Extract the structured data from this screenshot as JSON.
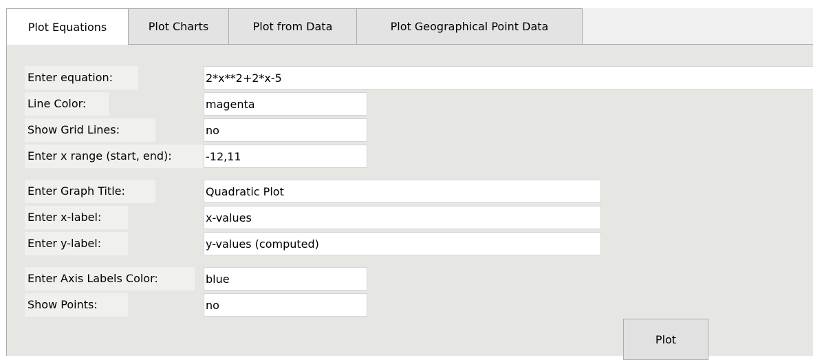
{
  "tabs": [
    {
      "label": "Plot Equations",
      "active": true
    },
    {
      "label": "Plot Charts",
      "active": false
    },
    {
      "label": "Plot from Data",
      "active": false
    },
    {
      "label": "Plot Geographical Point Data",
      "active": false
    }
  ],
  "form": {
    "equation": {
      "label": "Enter equation:",
      "value": "2*x**2+2*x-5"
    },
    "line_color": {
      "label": "Line Color:",
      "value": "magenta"
    },
    "show_grid": {
      "label": "Show Grid Lines:",
      "value": "no"
    },
    "x_range": {
      "label": "Enter x range (start, end):",
      "value": "-12,11"
    },
    "graph_title": {
      "label": "Enter Graph Title:",
      "value": "Quadratic Plot"
    },
    "x_label": {
      "label": "Enter x-label:",
      "value": "x-values"
    },
    "y_label": {
      "label": "Enter y-label:",
      "value": "y-values (computed)"
    },
    "axis_labels_color": {
      "label": "Enter Axis Labels Color:",
      "value": "blue"
    },
    "show_points": {
      "label": "Show Points:",
      "value": "no"
    }
  },
  "plot_button": {
    "label": "Plot"
  }
}
